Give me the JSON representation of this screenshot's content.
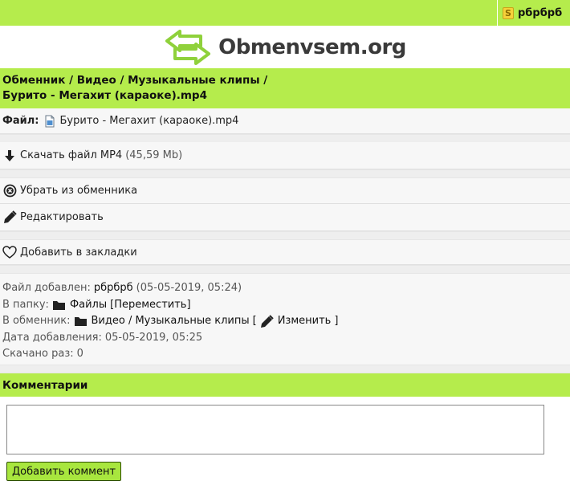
{
  "user": {
    "name": "рбрбрб",
    "coin_letter": "S"
  },
  "logo": {
    "text": "Obmenvsem.org"
  },
  "breadcrumb": {
    "path": "Обменник / Видео / Музыкальные клипы /",
    "title": "Бурито - Мегахит (караоке).mp4"
  },
  "file": {
    "label": "Файл:",
    "name": "Бурито - Мегахит (караоке).mp4"
  },
  "actions": {
    "download_label": "Скачать файл MP4",
    "download_size": "(45,59 Mb)",
    "remove_label": "Убрать из обменника",
    "edit_label": "Редактировать",
    "bookmark_label": "Добавить в закладки"
  },
  "info": {
    "added_label": "Файл добавлен:",
    "added_user": "рбрбрб",
    "added_time": "(05-05-2019, 05:24)",
    "folder_label": "В папку:",
    "folder_name": "Файлы",
    "move_link": "[Переместить]",
    "exchange_label": "В обменник:",
    "exchange_path": "Видео / Музыкальные клипы",
    "bracket_open": "[",
    "change_link": "Изменить",
    "bracket_close": "]",
    "date_label": "Дата добавления:",
    "date_value": "05-05-2019, 05:25",
    "downloads_label": "Скачано раз:",
    "downloads_value": "0"
  },
  "comments": {
    "header": "Комментарии",
    "textarea_value": "",
    "submit_label": "Добавить коммент"
  },
  "colors": {
    "accent": "#b5ec4c",
    "row_bg": "#f7f7f7"
  }
}
